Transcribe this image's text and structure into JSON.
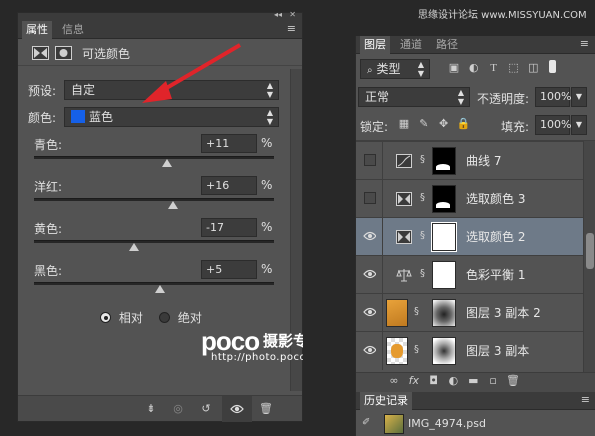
{
  "watermark_top": "思缘设计论坛  www.MISSYUAN.COM",
  "properties_panel": {
    "tabs": [
      "属性",
      "信息"
    ],
    "collapse_glyph": "◂◂",
    "close_glyph": "✕",
    "menu_glyph": "≡",
    "title": "可选颜色",
    "preset_label": "预设:",
    "preset_value": "自定",
    "color_label": "颜色:",
    "color_value": "蓝色",
    "color_swatch": "#1560e8",
    "sliders": [
      {
        "label": "青色:",
        "value": "+11",
        "unit": "%",
        "level": 0.555
      },
      {
        "label": "洋红:",
        "value": "+16",
        "unit": "%",
        "level": 0.58
      },
      {
        "label": "黄色:",
        "value": "-17",
        "unit": "%",
        "level": 0.415
      },
      {
        "label": "黑色:",
        "value": "+5",
        "unit": "%",
        "level": 0.525
      }
    ],
    "mode_relative": "相对",
    "mode_absolute": "绝对",
    "mode_selected": "relative"
  },
  "watermark": {
    "brand": "poco",
    "title": "摄影专题",
    "url": "http://photo.poco.cn/"
  },
  "layers_panel": {
    "tabs": [
      "图层",
      "通道",
      "路径"
    ],
    "kind_label": "类型",
    "blend_mode": "正常",
    "opacity_label": "不透明度:",
    "opacity_value": "100%",
    "lock_label": "锁定:",
    "fill_label": "填充:",
    "fill_value": "100%",
    "layers": [
      {
        "name": "曲线 7",
        "visible": false,
        "selected": false
      },
      {
        "name": "选取颜色 3",
        "visible": false,
        "selected": false
      },
      {
        "name": "选取颜色 2",
        "visible": true,
        "selected": true
      },
      {
        "name": "色彩平衡 1",
        "visible": true,
        "selected": false
      },
      {
        "name": "图层 3 副本 2",
        "visible": true,
        "selected": false
      },
      {
        "name": "图层 3 副本",
        "visible": true,
        "selected": false
      }
    ]
  },
  "history_panel": {
    "tab": "历史记录",
    "snapshot": "IMG_4974.psd"
  },
  "colors": {
    "accent_arrow": "#e0242a",
    "selected_row": "#6e7a88"
  }
}
